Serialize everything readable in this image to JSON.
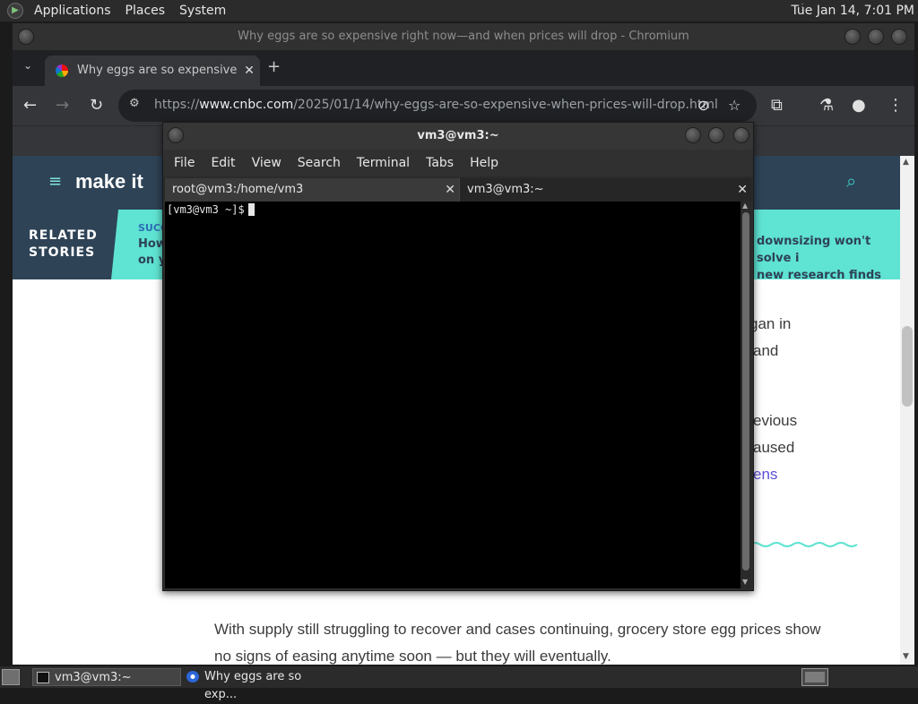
{
  "top_panel": {
    "menus": [
      "Applications",
      "Places",
      "System"
    ],
    "clock": "Tue Jan 14,  7:01 PM"
  },
  "chromium": {
    "window_title": "Why eggs are so expensive right now—and when prices will drop - Chromium",
    "tab": {
      "title": "Why eggs are so expensive n"
    },
    "url": {
      "scheme": "https://",
      "host": "www.cnbc.com",
      "path": "/2025/01/14/why-eggs-are-so-expensive-when-prices-will-drop.html"
    }
  },
  "page": {
    "logo": "make it",
    "related": {
      "label_line1": "RELATED",
      "label_line2": "STORIES",
      "left_kicker": "SUCC",
      "left_line1": "How",
      "left_line2": "on y",
      "right_line1": "downsizing won't solve i",
      "right_line2": "new research finds"
    },
    "fragments": [
      "gan in",
      "and",
      "evious",
      "aused",
      "ens"
    ],
    "paragraph": "With supply still struggling to recover and cases continuing, grocery store egg prices show no signs of easing anytime soon — but they will eventually."
  },
  "terminal": {
    "title": "vm3@vm3:~",
    "menu": [
      "File",
      "Edit",
      "View",
      "Search",
      "Terminal",
      "Tabs",
      "Help"
    ],
    "tabs": [
      "root@vm3:/home/vm3",
      "vm3@vm3:~"
    ],
    "prompt": "[vm3@vm3 ~]$"
  },
  "taskbar": {
    "items": [
      "vm3@vm3:~",
      "Why eggs are so exp..."
    ]
  }
}
